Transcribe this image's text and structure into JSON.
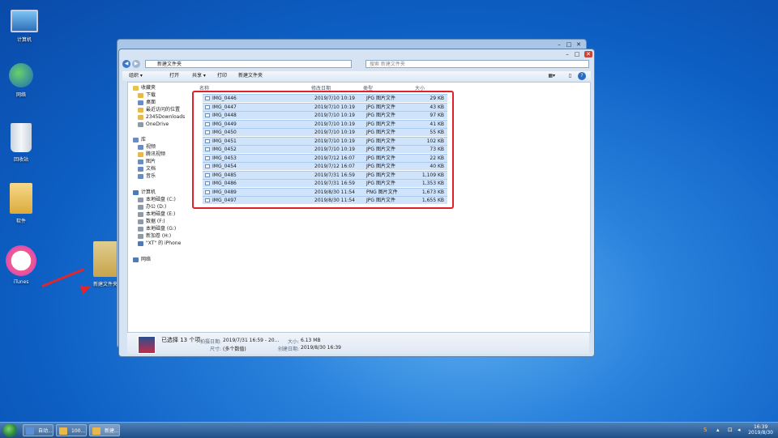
{
  "desktop": {
    "icons": [
      {
        "label": "计算机"
      },
      {
        "label": "网络"
      },
      {
        "label": "回收站"
      },
      {
        "label": "软件"
      },
      {
        "label": "iTunes"
      },
      {
        "label": "新建文件夹"
      }
    ]
  },
  "window": {
    "back_title": "",
    "address": "新建文件夹",
    "search_placeholder": "搜索 新建文件夹",
    "toolbar": {
      "organize": "组织 ▾",
      "open": "打开",
      "share": "共享 ▾",
      "print": "打印",
      "new_folder": "新建文件夹"
    },
    "nav": {
      "favorites": "收藏夹",
      "fav_items": [
        "下载",
        "桌面",
        "最近访问的位置",
        "2345Downloads",
        "OneDrive"
      ],
      "library": "库",
      "lib_items": [
        "视频",
        "腾讯视频",
        "图片",
        "文档",
        "音乐"
      ],
      "computer": "计算机",
      "drives": [
        "本地磁盘 (C:)",
        "办公 (D:)",
        "本地磁盘 (E:)",
        "数据 (F:)",
        "本地磁盘 (G:)",
        "新加卷 (H:)",
        "\"XT\" 的 iPhone"
      ],
      "network": "网络"
    },
    "columns": {
      "name": "名称",
      "date": "修改日期",
      "type": "类型",
      "size": "大小"
    },
    "files": [
      {
        "name": "IMG_0446",
        "date": "2019/7/10 10:19",
        "type": "JPG 图片文件",
        "size": "29 KB"
      },
      {
        "name": "IMG_0447",
        "date": "2019/7/10 10:19",
        "type": "JPG 图片文件",
        "size": "43 KB"
      },
      {
        "name": "IMG_0448",
        "date": "2019/7/10 10:19",
        "type": "JPG 图片文件",
        "size": "97 KB"
      },
      {
        "name": "IMG_0449",
        "date": "2019/7/10 10:19",
        "type": "JPG 图片文件",
        "size": "41 KB"
      },
      {
        "name": "IMG_0450",
        "date": "2019/7/10 10:19",
        "type": "JPG 图片文件",
        "size": "55 KB"
      },
      {
        "name": "IMG_0451",
        "date": "2019/7/10 10:19",
        "type": "JPG 图片文件",
        "size": "102 KB"
      },
      {
        "name": "IMG_0452",
        "date": "2019/7/10 10:19",
        "type": "JPG 图片文件",
        "size": "73 KB"
      },
      {
        "name": "IMG_0453",
        "date": "2019/7/12 16:07",
        "type": "JPG 图片文件",
        "size": "22 KB"
      },
      {
        "name": "IMG_0454",
        "date": "2019/7/12 16:07",
        "type": "JPG 图片文件",
        "size": "40 KB"
      },
      {
        "name": "IMG_0485",
        "date": "2019/7/31 16:59",
        "type": "JPG 图片文件",
        "size": "1,109 KB"
      },
      {
        "name": "IMG_0486",
        "date": "2019/7/31 16:59",
        "type": "JPG 图片文件",
        "size": "1,353 KB"
      },
      {
        "name": "IMG_0489",
        "date": "2019/8/30 11:54",
        "type": "PNG 图片文件",
        "size": "1,673 KB"
      },
      {
        "name": "IMG_0497",
        "date": "2019/8/30 11:54",
        "type": "JPG 图片文件",
        "size": "1,655 KB"
      }
    ],
    "details": {
      "selected": "已选择 13 个项",
      "shot_date_label": "拍摄日期:",
      "shot_date": "2019/7/31 16:59 - 20...",
      "size_label": "大小:",
      "size": "6.13 MB",
      "dims_label": "尺寸:",
      "dims": "(多个数值)",
      "created_label": "创建日期:",
      "created": "2019/8/30 16:39"
    }
  },
  "taskbar": {
    "buttons": [
      "自动...",
      "100...",
      "新建..."
    ],
    "time": "16:39",
    "date": "2019/8/30"
  },
  "colors": {
    "highlight": "#e0202a",
    "selection": "#cfe3fb"
  }
}
